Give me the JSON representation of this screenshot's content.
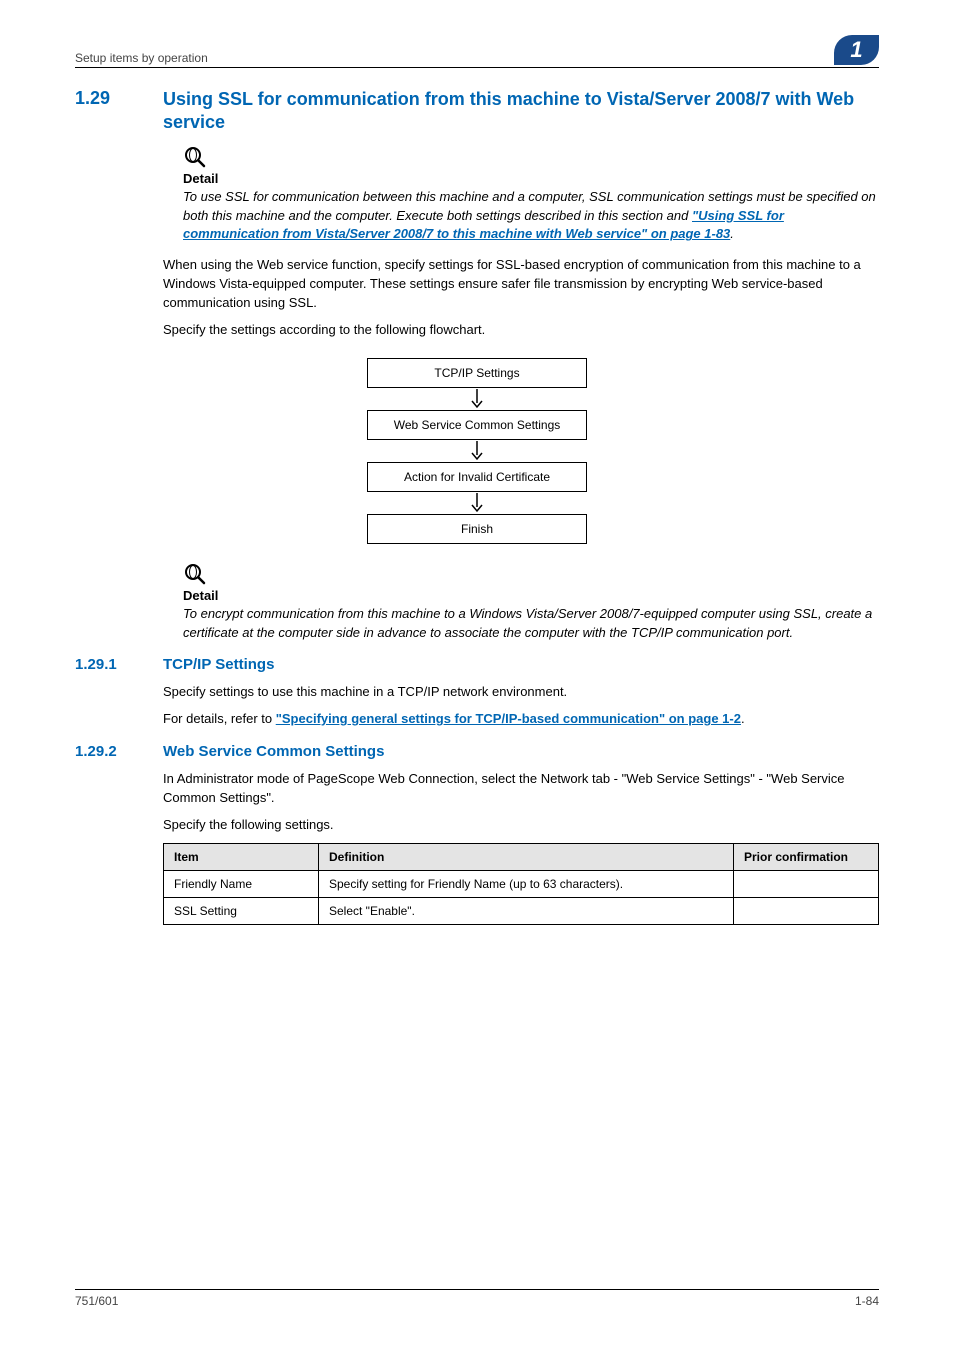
{
  "header": {
    "breadcrumb": "Setup items by operation",
    "chapter_number": "1"
  },
  "section": {
    "number": "1.29",
    "title": "Using SSL for communication from this machine to Vista/Server 2008/7 with Web service"
  },
  "detail1": {
    "heading": "Detail",
    "body_prefix": "To use SSL for communication between this machine and a computer, SSL communication settings must be specified on both this machine and the computer. Execute both settings described in this section and ",
    "body_link": "\"Using SSL for communication from Vista/Server 2008/7 to this machine with Web service\" on page 1-83",
    "body_suffix": "."
  },
  "paras": {
    "p1": "When using the Web service function, specify settings for SSL-based encryption of communication from this machine to a Windows Vista-equipped computer. These settings ensure safer file transmission by encrypting Web service-based communication using SSL.",
    "p2": "Specify the settings according to the following flowchart."
  },
  "flow": {
    "n1": "TCP/IP Settings",
    "n2": "Web Service Common Settings",
    "n3": "Action for Invalid Certificate",
    "n4": "Finish"
  },
  "detail2": {
    "heading": "Detail",
    "body": "To encrypt communication from this machine to a Windows Vista/Server 2008/7-equipped computer using SSL, create a certificate at the computer side in advance to associate the computer with the TCP/IP communication port."
  },
  "sub1": {
    "number": "1.29.1",
    "title": "TCP/IP Settings",
    "p1": "Specify settings to use this machine in a TCP/IP network environment.",
    "p2_prefix": "For details, refer to ",
    "p2_link": "\"Specifying general settings for TCP/IP-based communication\" on page 1-2",
    "p2_suffix": "."
  },
  "sub2": {
    "number": "1.29.2",
    "title": "Web Service Common Settings",
    "p1": "In Administrator mode of PageScope Web Connection, select the Network tab - \"Web Service Settings\" - \"Web Service Common Settings\".",
    "p2": "Specify the following settings."
  },
  "table": {
    "headers": {
      "item": "Item",
      "definition": "Definition",
      "prior": "Prior confirmation"
    },
    "rows": [
      {
        "item": "Friendly Name",
        "definition": "Specify setting for Friendly Name (up to 63 characters).",
        "prior": ""
      },
      {
        "item": "SSL Setting",
        "definition": "Select \"Enable\".",
        "prior": ""
      }
    ]
  },
  "footer": {
    "left": "751/601",
    "right": "1-84"
  }
}
